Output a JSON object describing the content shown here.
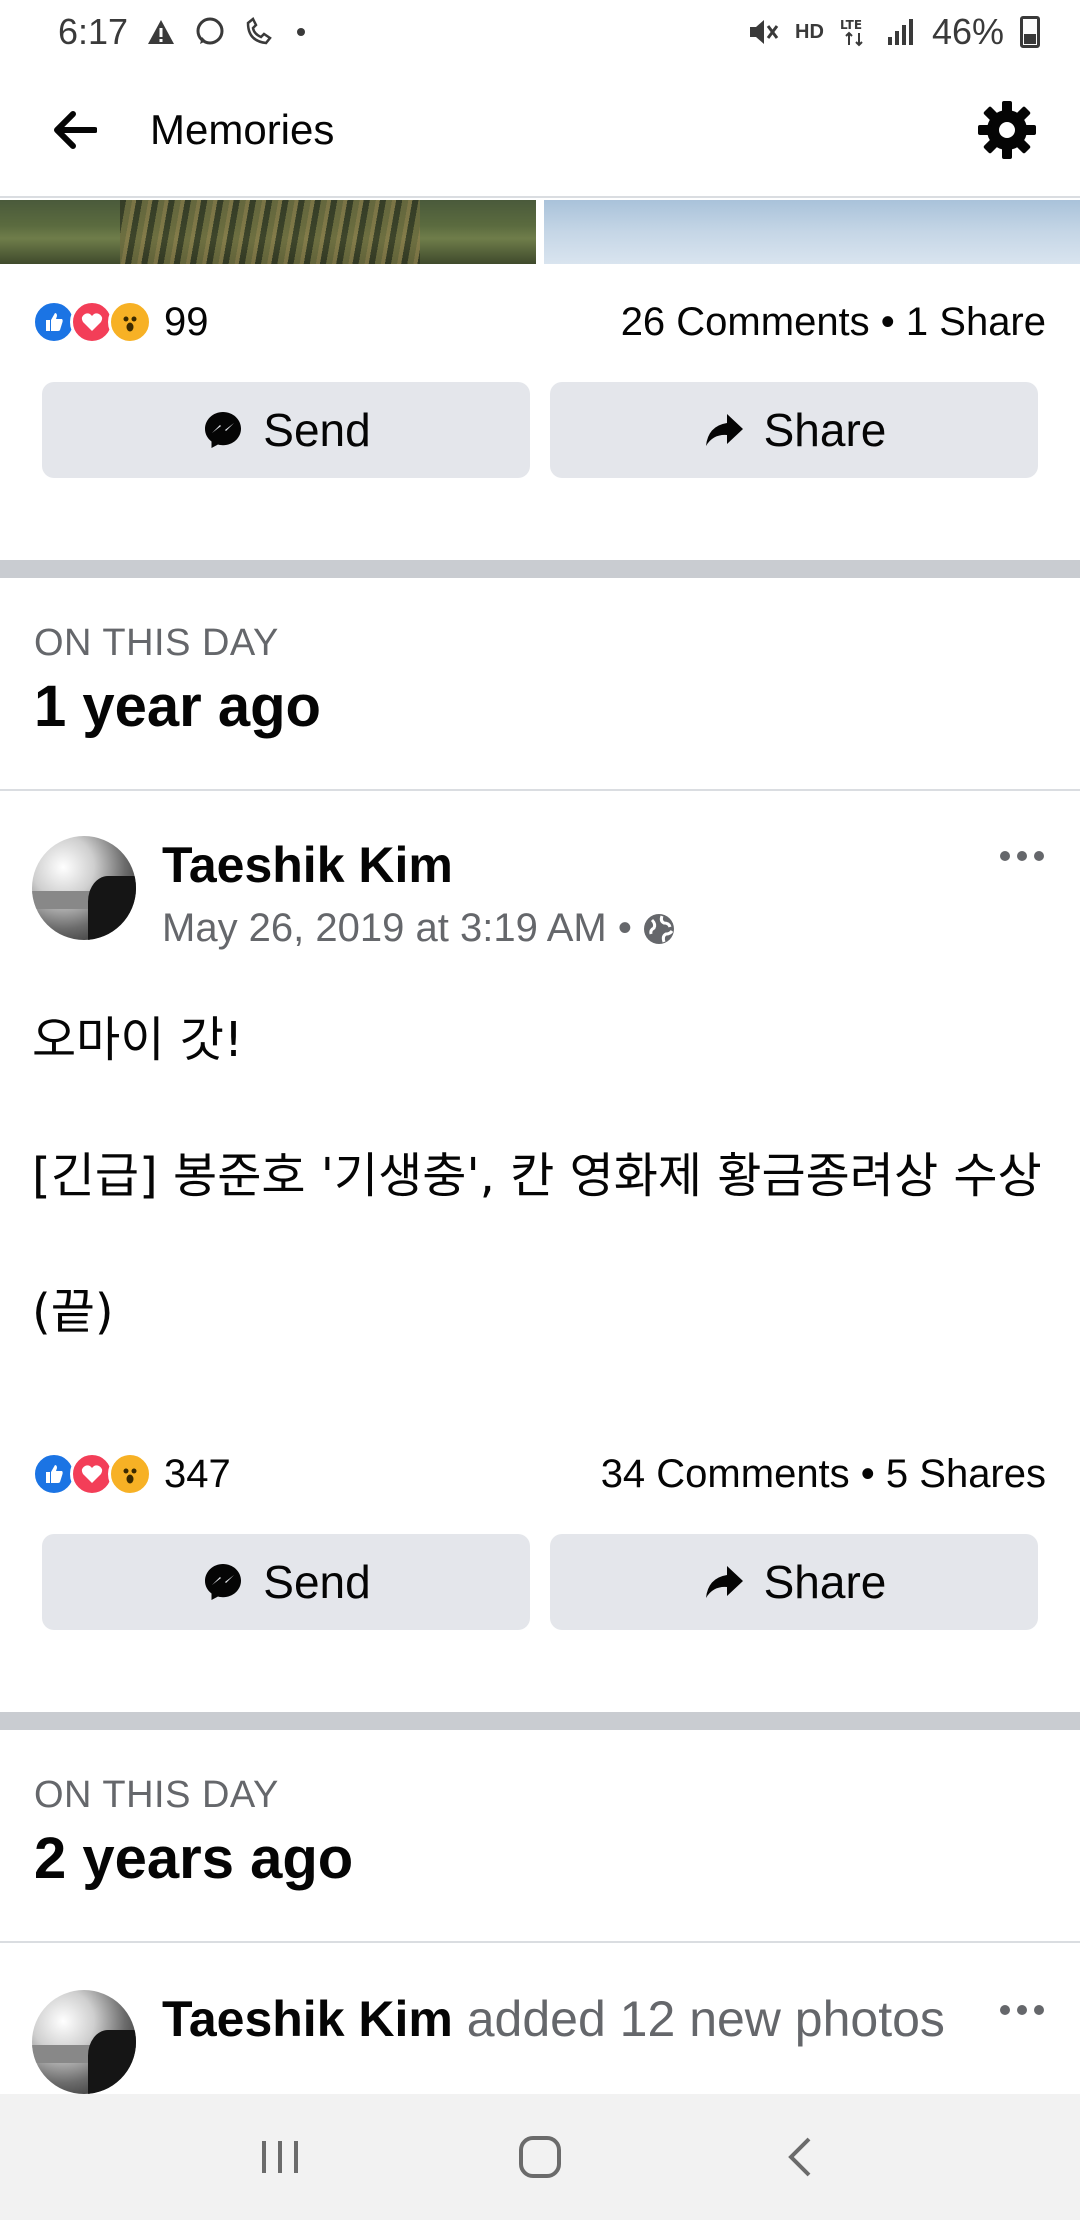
{
  "status_bar": {
    "time": "6:17",
    "signal_label": "HD",
    "battery": "46%"
  },
  "header": {
    "title": "Memories",
    "back_icon": "arrow-left-icon",
    "settings_icon": "gear-icon"
  },
  "post1": {
    "reaction_count": "99",
    "stats": "26 Comments • 1 Share",
    "send_label": "Send",
    "share_label": "Share"
  },
  "section1": {
    "label": "ON THIS DAY",
    "title": "1 year ago"
  },
  "post2": {
    "author": "Taeshik Kim",
    "time": "May 26, 2019 at 3:19 AM •",
    "body": [
      "오마이 갓!",
      "",
      "[긴급] 봉준호 '기생충', 칸 영화제 황금종려상 수상",
      "",
      "(끝)"
    ],
    "reaction_count": "347",
    "stats": "34 Comments • 5 Shares",
    "send_label": "Send",
    "share_label": "Share"
  },
  "section2": {
    "label": "ON THIS DAY",
    "title": "2 years ago"
  },
  "post3": {
    "author": "Taeshik Kim",
    "action": " added 12 new photos"
  },
  "colors": {
    "accent": "#1b74e4",
    "button_bg": "#e4e6eb",
    "secondary_text": "#65676b"
  }
}
